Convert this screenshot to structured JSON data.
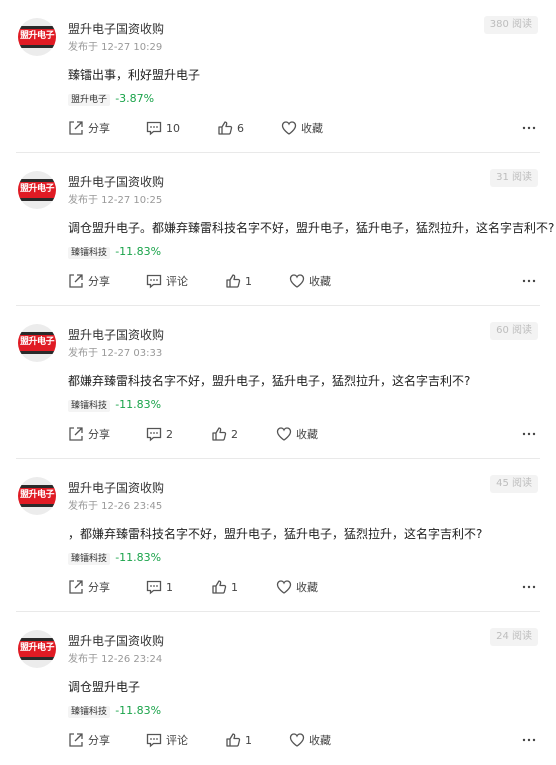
{
  "posts": [
    {
      "avatar_text": "盟升电子",
      "username": "盟升电子国资收购",
      "timestamp": "发布于 12-27 10:29",
      "reads": "380 阅读",
      "content": "臻镭出事，利好盟升电子",
      "stock_name": "盟升电子",
      "stock_change": "-3.87%",
      "share": "分享",
      "comment": "10",
      "like": "6",
      "favorite": "收藏"
    },
    {
      "avatar_text": "盟升电子",
      "username": "盟升电子国资收购",
      "timestamp": "发布于 12-27 10:25",
      "reads": "31 阅读",
      "content": "调仓盟升电子。都嫌弃臻雷科技名字不好，盟升电子，猛升电子，猛烈拉升，这名字吉利不?",
      "stock_name": "臻镭科技",
      "stock_change": "-11.83%",
      "share": "分享",
      "comment": "评论",
      "like": "1",
      "favorite": "收藏"
    },
    {
      "avatar_text": "盟升电子",
      "username": "盟升电子国资收购",
      "timestamp": "发布于 12-27 03:33",
      "reads": "60 阅读",
      "content": "都嫌弃臻雷科技名字不好，盟升电子，猛升电子，猛烈拉升，这名字吉利不?",
      "stock_name": "臻镭科技",
      "stock_change": "-11.83%",
      "share": "分享",
      "comment": "2",
      "like": "2",
      "favorite": "收藏"
    },
    {
      "avatar_text": "盟升电子",
      "username": "盟升电子国资收购",
      "timestamp": "发布于 12-26 23:45",
      "reads": "45 阅读",
      "content": "，都嫌弃臻雷科技名字不好，盟升电子，猛升电子，猛烈拉升，这名字吉利不?",
      "stock_name": "臻镭科技",
      "stock_change": "-11.83%",
      "share": "分享",
      "comment": "1",
      "like": "1",
      "favorite": "收藏"
    },
    {
      "avatar_text": "盟升电子",
      "username": "盟升电子国资收购",
      "timestamp": "发布于 12-26 23:24",
      "reads": "24 阅读",
      "content": "调仓盟升电子",
      "stock_name": "臻镭科技",
      "stock_change": "-11.83%",
      "share": "分享",
      "comment": "评论",
      "like": "1",
      "favorite": "收藏"
    }
  ],
  "colors": {
    "negative_change": "#1aa34a",
    "avatar_red": "#e01b24",
    "divider": "#e9e9e9"
  }
}
